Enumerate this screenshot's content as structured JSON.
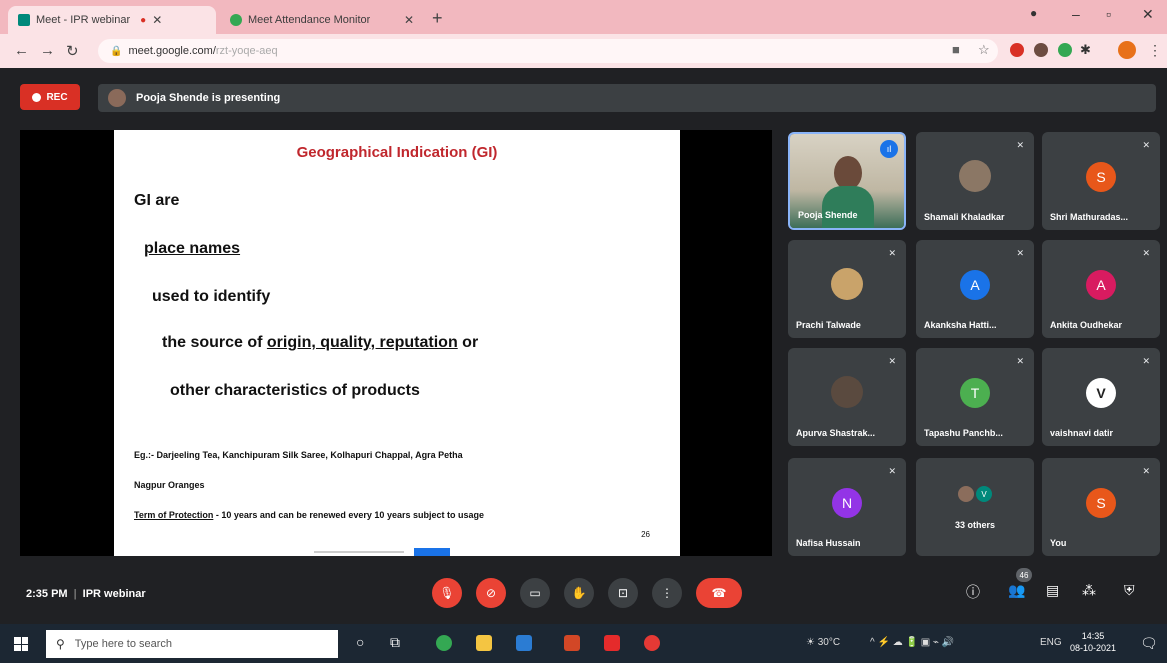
{
  "browser": {
    "tabs": [
      {
        "title": "Meet - IPR webinar",
        "active": true,
        "recording": true
      },
      {
        "title": "Meet Attendance Monitor",
        "active": false
      }
    ],
    "url_host": "meet.google.com/",
    "url_rest": "rzt-yoqe-aeq"
  },
  "meet": {
    "rec_label": "REC",
    "presenting_text": "Pooja Shende is presenting",
    "meeting_time": "2:35 PM",
    "meeting_name": "IPR webinar",
    "people_count": "46"
  },
  "slide": {
    "title": "Geographical Indication (GI)",
    "line1": "GI are",
    "line2": "place names",
    "line3": "used to identify",
    "line4_pre": "the source of ",
    "line4_u": "origin, quality, reputation",
    "line4_post": " or",
    "line5": "other characteristics of products",
    "eg": "Eg.:-  Darjeeling Tea, Kanchipuram Silk Saree,  Kolhapuri Chappal, Agra Petha",
    "eg2": "Nagpur Oranges",
    "term_u": "Term of Protection",
    "term_rest": " - 10 years and can be renewed every 10 years subject to usage",
    "page": "26"
  },
  "participants": [
    {
      "name": "Pooja Shende",
      "type": "video",
      "speaking": true
    },
    {
      "name": "Shamali Khaladkar",
      "type": "photo"
    },
    {
      "name": "Shri Mathuradas...",
      "type": "initial",
      "initial": "S",
      "color": "#e8571a"
    },
    {
      "name": "Prachi Talwade",
      "type": "photo"
    },
    {
      "name": "Akanksha Hatti...",
      "type": "initial",
      "initial": "A",
      "color": "#1a73e8"
    },
    {
      "name": "Ankita Oudhekar",
      "type": "initial",
      "initial": "A",
      "color": "#d81b60"
    },
    {
      "name": "Apurva Shastrak...",
      "type": "photo"
    },
    {
      "name": "Tapashu Panchb...",
      "type": "initial",
      "initial": "T",
      "color": "#4caf50"
    },
    {
      "name": "vaishnavi datir",
      "type": "initial",
      "initial": "V",
      "color": "#ffffff"
    },
    {
      "name": "Nafisa Hussain",
      "type": "initial",
      "initial": "N",
      "color": "#9334e6"
    },
    {
      "name": "33 others",
      "type": "others"
    },
    {
      "name": "You",
      "type": "initial",
      "initial": "S",
      "color": "#e8571a"
    }
  ],
  "taskbar": {
    "search_placeholder": "Type here to search",
    "weather": "30°C",
    "lang": "ENG",
    "time": "14:35",
    "date": "08-10-2021"
  },
  "colors": {
    "accent": "#1a73e8",
    "danger": "#ea4335",
    "meet_bg": "#202124",
    "tab_strip": "#f2b8bf"
  }
}
